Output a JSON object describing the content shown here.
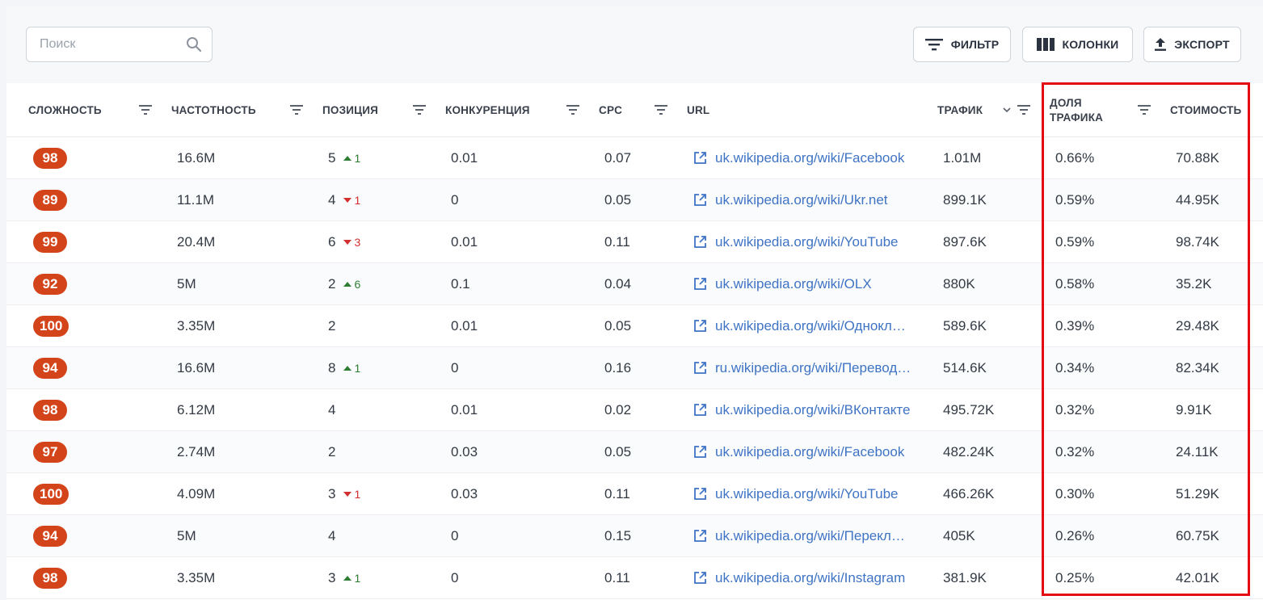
{
  "toolbar": {
    "search_placeholder": "Поиск",
    "filter_label": "ФИЛЬТР",
    "columns_label": "КОЛОНКИ",
    "export_label": "ЭКСПОРТ"
  },
  "columns": {
    "difficulty": "СЛОЖНОСТЬ",
    "frequency": "ЧАСТОТНОСТЬ",
    "position": "ПОЗИЦИЯ",
    "competition": "КОНКУРЕНЦИЯ",
    "cpc": "CPC",
    "url": "URL",
    "traffic": "ТРАФИК",
    "traffic_share_line1": "ДОЛЯ",
    "traffic_share_line2": "ТРАФИКА",
    "cost": "СТОИМОСТЬ"
  },
  "rows": [
    {
      "difficulty": "98",
      "frequency": "16.6M",
      "position": "5",
      "delta_dir": "up",
      "delta": "1",
      "competition": "0.01",
      "cpc": "0.07",
      "url": "uk.wikipedia.org/wiki/Facebook",
      "traffic": "1.01M",
      "share": "0.66%",
      "cost": "70.88K"
    },
    {
      "difficulty": "89",
      "frequency": "11.1M",
      "position": "4",
      "delta_dir": "down",
      "delta": "1",
      "competition": "0",
      "cpc": "0.05",
      "url": "uk.wikipedia.org/wiki/Ukr.net",
      "traffic": "899.1K",
      "share": "0.59%",
      "cost": "44.95K"
    },
    {
      "difficulty": "99",
      "frequency": "20.4M",
      "position": "6",
      "delta_dir": "down",
      "delta": "3",
      "competition": "0.01",
      "cpc": "0.11",
      "url": "uk.wikipedia.org/wiki/YouTube",
      "traffic": "897.6K",
      "share": "0.59%",
      "cost": "98.74K"
    },
    {
      "difficulty": "92",
      "frequency": "5M",
      "position": "2",
      "delta_dir": "up",
      "delta": "6",
      "competition": "0.1",
      "cpc": "0.04",
      "url": "uk.wikipedia.org/wiki/OLX",
      "traffic": "880K",
      "share": "0.58%",
      "cost": "35.2K"
    },
    {
      "difficulty": "100",
      "frequency": "3.35M",
      "position": "2",
      "delta_dir": "",
      "delta": "",
      "competition": "0.01",
      "cpc": "0.05",
      "url": "uk.wikipedia.org/wiki/Однокласники",
      "traffic": "589.6K",
      "share": "0.39%",
      "cost": "29.48K"
    },
    {
      "difficulty": "94",
      "frequency": "16.6M",
      "position": "8",
      "delta_dir": "up",
      "delta": "1",
      "competition": "0",
      "cpc": "0.16",
      "url": "ru.wikipedia.org/wiki/Переводчик",
      "traffic": "514.6K",
      "share": "0.34%",
      "cost": "82.34K"
    },
    {
      "difficulty": "98",
      "frequency": "6.12M",
      "position": "4",
      "delta_dir": "",
      "delta": "",
      "competition": "0.01",
      "cpc": "0.02",
      "url": "uk.wikipedia.org/wiki/ВКонтакте",
      "traffic": "495.72K",
      "share": "0.32%",
      "cost": "9.91K"
    },
    {
      "difficulty": "97",
      "frequency": "2.74M",
      "position": "2",
      "delta_dir": "",
      "delta": "",
      "competition": "0.03",
      "cpc": "0.05",
      "url": "uk.wikipedia.org/wiki/Facebook",
      "traffic": "482.24K",
      "share": "0.32%",
      "cost": "24.11K"
    },
    {
      "difficulty": "100",
      "frequency": "4.09M",
      "position": "3",
      "delta_dir": "down",
      "delta": "1",
      "competition": "0.03",
      "cpc": "0.11",
      "url": "uk.wikipedia.org/wiki/YouTube",
      "traffic": "466.26K",
      "share": "0.30%",
      "cost": "51.29K"
    },
    {
      "difficulty": "94",
      "frequency": "5M",
      "position": "4",
      "delta_dir": "",
      "delta": "",
      "competition": "0",
      "cpc": "0.15",
      "url": "uk.wikipedia.org/wiki/Перекладач",
      "traffic": "405K",
      "share": "0.26%",
      "cost": "60.75K"
    },
    {
      "difficulty": "98",
      "frequency": "3.35M",
      "position": "3",
      "delta_dir": "up",
      "delta": "1",
      "competition": "0",
      "cpc": "0.11",
      "url": "uk.wikipedia.org/wiki/Instagram",
      "traffic": "381.9K",
      "share": "0.25%",
      "cost": "42.01K"
    }
  ],
  "colors": {
    "badge": "#d3441a",
    "link": "#3f73c4",
    "up": "#2e7d32",
    "down": "#d32f2f",
    "highlight": "#e50914"
  }
}
